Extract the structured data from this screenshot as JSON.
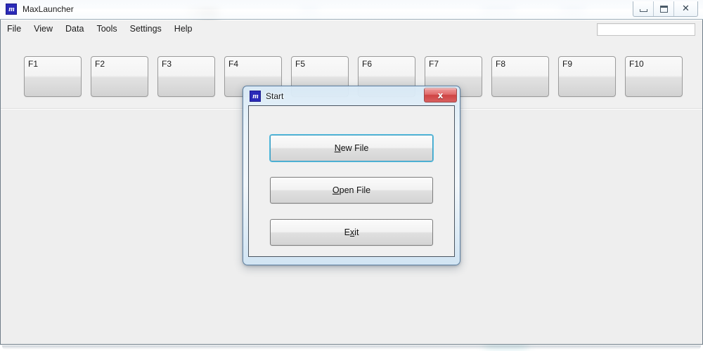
{
  "window": {
    "title": "MaxLauncher",
    "icon": "app-logo-icon",
    "controls": {
      "minimize": "minimize-icon",
      "maximize": "maximize-icon",
      "close": "close-icon",
      "close_glyph": "✕"
    }
  },
  "menu": {
    "items": [
      {
        "label": "File"
      },
      {
        "label": "View"
      },
      {
        "label": "Data"
      },
      {
        "label": "Tools"
      },
      {
        "label": "Settings"
      },
      {
        "label": "Help"
      }
    ],
    "search": {
      "value": "",
      "placeholder": ""
    }
  },
  "toolbar": {
    "fkeys": [
      {
        "label": "F1"
      },
      {
        "label": "F2"
      },
      {
        "label": "F3"
      },
      {
        "label": "F4"
      },
      {
        "label": "F5"
      },
      {
        "label": "F6"
      },
      {
        "label": "F7"
      },
      {
        "label": "F8"
      },
      {
        "label": "F9"
      },
      {
        "label": "F10"
      }
    ]
  },
  "dialog": {
    "title": "Start",
    "icon": "app-logo-icon",
    "close_glyph": "x",
    "buttons": [
      {
        "name": "new-file-button",
        "pre": "",
        "mnemonic": "N",
        "post": "ew File",
        "focused": true
      },
      {
        "name": "open-file-button",
        "pre": "",
        "mnemonic": "O",
        "post": "pen File",
        "focused": false
      },
      {
        "name": "exit-button",
        "pre": "E",
        "mnemonic": "x",
        "post": "it",
        "focused": false
      }
    ]
  },
  "colors": {
    "accent_blue": "#3c9ec4",
    "close_red": "#cf4343",
    "icon_blue": "#2a2ab8",
    "panel_gray": "#f0f0f0",
    "client_gray": "#eeeeee"
  }
}
